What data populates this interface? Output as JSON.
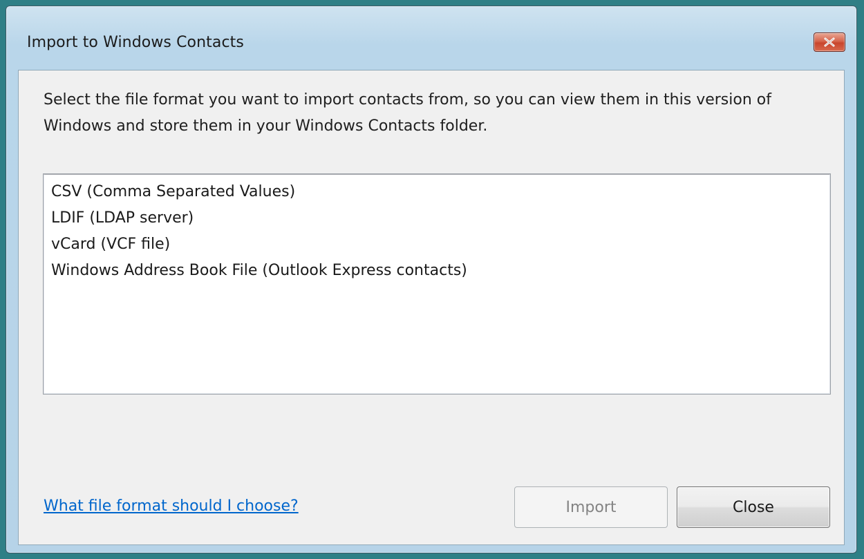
{
  "window": {
    "title": "Import to Windows Contacts",
    "close_icon": "close-x-icon",
    "colors": {
      "close_button": "#c8452d",
      "link": "#0066cc",
      "client_background": "#f0f0f0"
    }
  },
  "main": {
    "description": "Select the file format you want to import contacts from, so you can view them in this version of Windows and store them in your Windows Contacts folder.",
    "formats": [
      {
        "label": "CSV (Comma Separated Values)"
      },
      {
        "label": "LDIF (LDAP server)"
      },
      {
        "label": "vCard (VCF file)"
      },
      {
        "label": "Windows Address Book File (Outlook Express contacts)"
      }
    ]
  },
  "footer": {
    "help_link": "What file format should I choose?",
    "import_label": "Import",
    "close_label": "Close"
  }
}
